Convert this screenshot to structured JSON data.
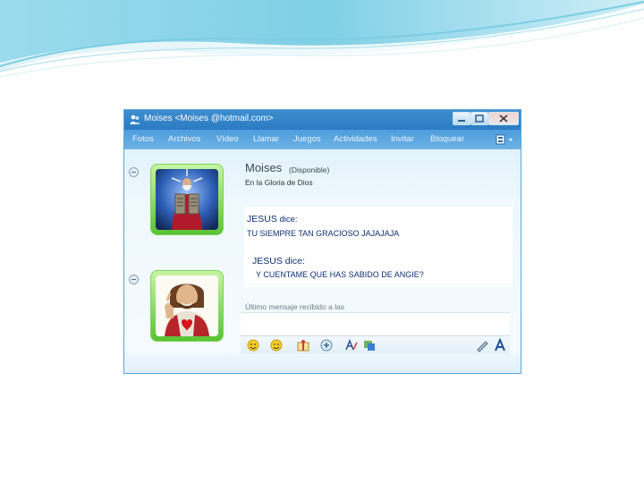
{
  "window": {
    "title": "Moises <Moises @hotmail.com>"
  },
  "menu": [
    "Fotos",
    "Archivos",
    "Vídeo",
    "Llamar",
    "Juegos",
    "Actividades",
    "Invitar",
    "Bloquear"
  ],
  "contact": {
    "name": "Moises",
    "status": "(Disponible)",
    "personal_message": "En la Gloria de Dios"
  },
  "conversation": [
    {
      "sender": "JESUS",
      "dice": " dice:",
      "text": "TU SIEMPRE TAN GRACIOSO JAJAJAJA"
    },
    {
      "sender": "JESUS",
      "dice": " dice:",
      "text": "Y CUENTAME QUE HAS SABIDO DE ANGIE?"
    }
  ],
  "last_message": "Último mensaje recibido a las",
  "icons": [
    "windows-live-icon",
    "minimize-icon",
    "maximize-icon",
    "close-icon",
    "menu-options-icon",
    "emoticon-icon",
    "wink-icon",
    "gift-icon",
    "nudge-icon",
    "font-icon",
    "background-icon",
    "handwriting-icon",
    "text-style-icon"
  ],
  "colors": {
    "accent": "#3d8ed0",
    "text": "#0c2f73",
    "frame": "#56c232"
  }
}
